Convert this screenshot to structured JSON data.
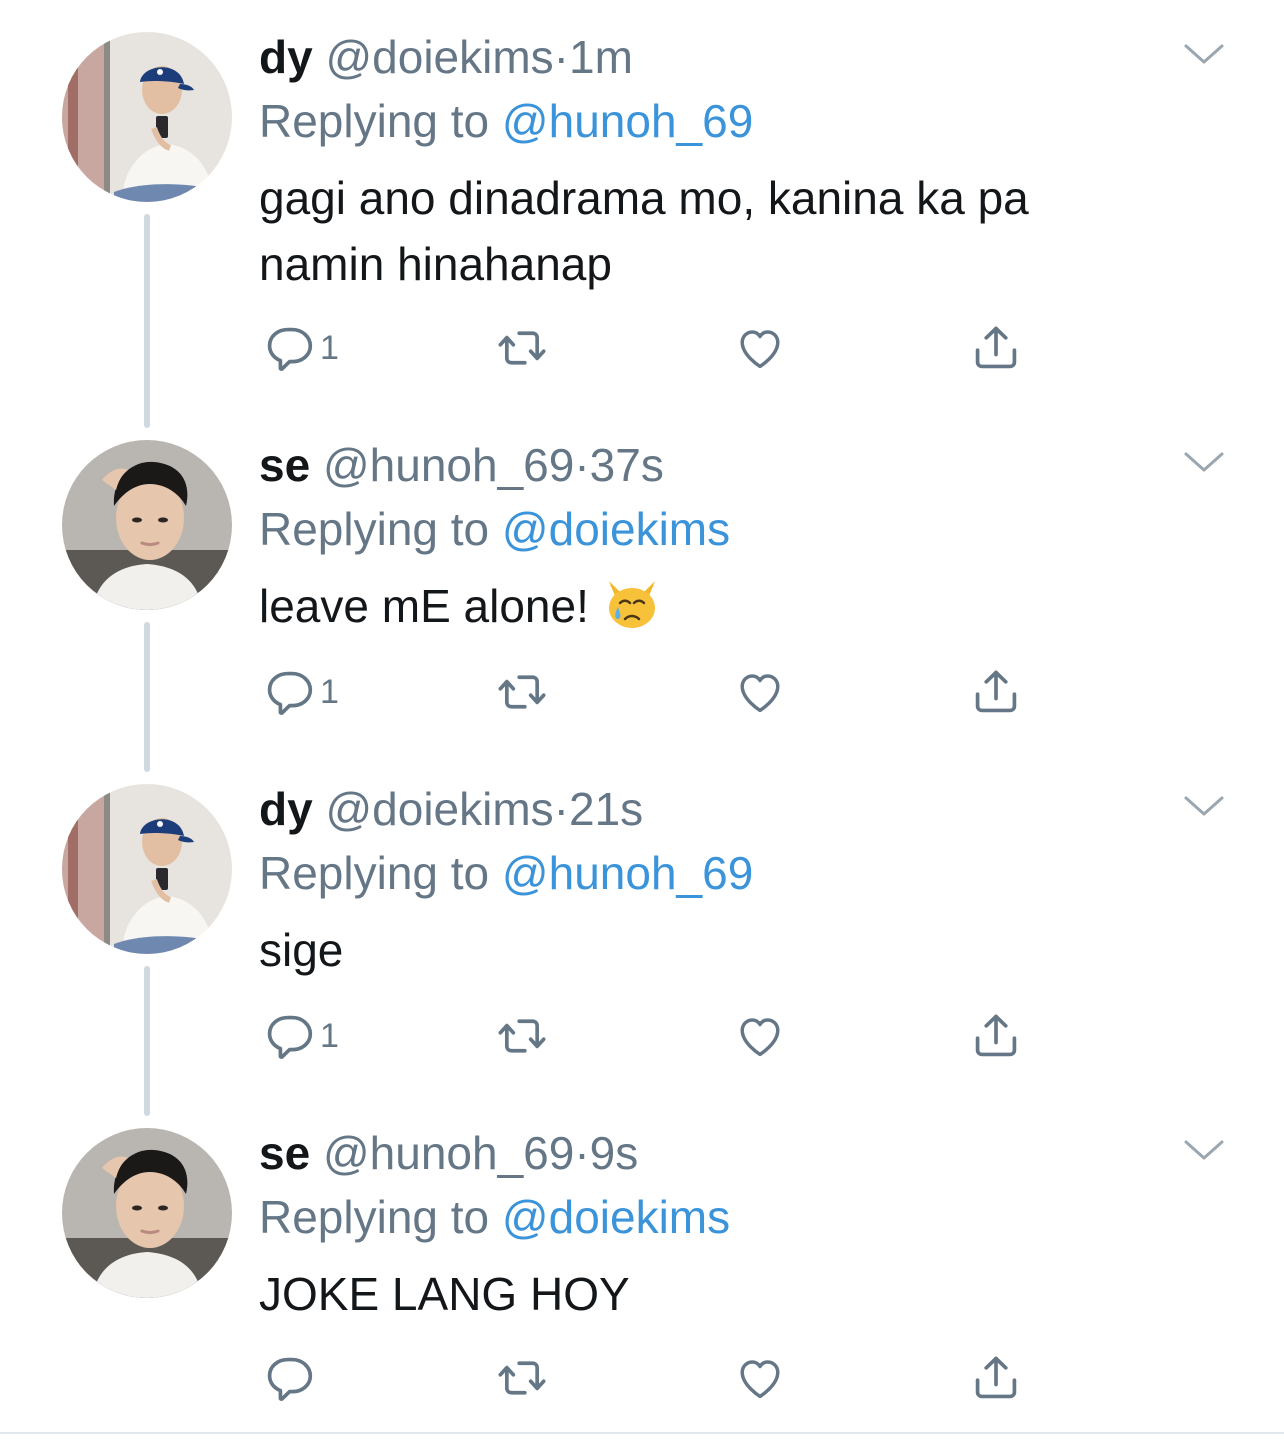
{
  "tweets": [
    {
      "name": "dy",
      "handle": "@doiekims",
      "dot": "·",
      "time": "1m",
      "replying_prefix": "Replying to",
      "replying_to": "@hunoh_69",
      "text": "gagi ano dinadrama mo, kanina ka pa namin hinahanap",
      "reply_count": "1",
      "avatar": "dy-avatar"
    },
    {
      "name": "se",
      "handle": "@hunoh_69",
      "dot": "·",
      "time": "37s",
      "replying_prefix": "Replying to",
      "replying_to": "@doiekims",
      "text": "leave mE alone!",
      "reply_count": "1",
      "avatar": "se-avatar",
      "emoji": "crying-cat-face"
    },
    {
      "name": "dy",
      "handle": "@doiekims",
      "dot": "·",
      "time": "21s",
      "replying_prefix": "Replying to",
      "replying_to": "@hunoh_69",
      "text": "sige",
      "reply_count": "1",
      "avatar": "dy-avatar"
    },
    {
      "name": "se",
      "handle": "@hunoh_69",
      "dot": "·",
      "time": "9s",
      "replying_prefix": "Replying to",
      "replying_to": "@doiekims",
      "text": "JOKE LANG HOY",
      "reply_count": "",
      "avatar": "se-avatar"
    }
  ],
  "icons": {
    "reply": "reply-icon",
    "retweet": "retweet-icon",
    "like": "heart-icon",
    "share": "share-icon",
    "menu": "chevron-down-icon"
  },
  "colors": {
    "link": "#3b94d9",
    "muted": "#657786",
    "text": "#14171a",
    "thread_line": "#cfd9de"
  }
}
